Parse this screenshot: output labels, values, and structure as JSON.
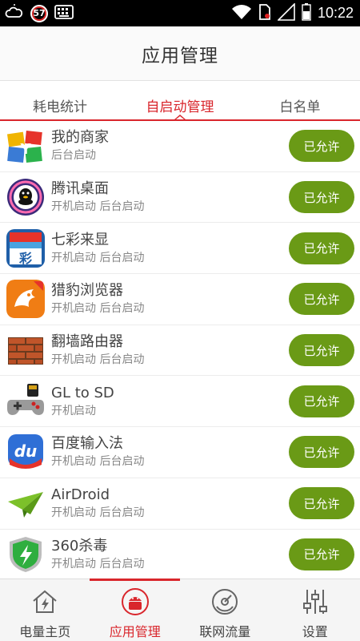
{
  "status_bar": {
    "time": "10:22",
    "badge": "57",
    "icons": [
      "weather-icon",
      "notification-badge",
      "keyboard-icon",
      "wifi-icon",
      "no-sim-icon",
      "signal-icon",
      "battery-icon"
    ]
  },
  "header": {
    "title": "应用管理"
  },
  "tabs": [
    {
      "label": "耗电统计",
      "active": false
    },
    {
      "label": "自启动管理",
      "active": true
    },
    {
      "label": "白名单",
      "active": false
    }
  ],
  "colors": {
    "accent": "#d9262c",
    "button": "#6a9a16"
  },
  "apps": [
    {
      "name": "我的商家",
      "sub": "后台启动",
      "button": "已允许",
      "icon": "my-merchant-icon"
    },
    {
      "name": "腾讯桌面",
      "sub": "开机启动 后台启动",
      "button": "已允许",
      "icon": "tencent-desktop-icon"
    },
    {
      "name": "七彩来显",
      "sub": "开机启动 后台启动",
      "button": "已允许",
      "icon": "qicai-caller-icon"
    },
    {
      "name": "猎豹浏览器",
      "sub": "开机启动 后台启动",
      "button": "已允许",
      "icon": "cheetah-browser-icon"
    },
    {
      "name": "翻墙路由器",
      "sub": "开机启动 后台启动",
      "button": "已允许",
      "icon": "brick-wall-icon"
    },
    {
      "name": "GL to SD",
      "sub": "开机启动",
      "button": "已允许",
      "icon": "gamepad-icon"
    },
    {
      "name": "百度输入法",
      "sub": "开机启动 后台启动",
      "button": "已允许",
      "icon": "baidu-input-icon"
    },
    {
      "name": "AirDroid",
      "sub": "开机启动 后台启动",
      "button": "已允许",
      "icon": "airdroid-icon"
    },
    {
      "name": "360杀毒",
      "sub": "开机启动 后台启动",
      "button": "已允许",
      "icon": "360-antivirus-icon"
    }
  ],
  "bottom_nav": [
    {
      "label": "电量主页",
      "icon": "power-home-icon",
      "active": false
    },
    {
      "label": "应用管理",
      "icon": "android-app-icon",
      "active": true
    },
    {
      "label": "联网流量",
      "icon": "network-traffic-icon",
      "active": false
    },
    {
      "label": "设置",
      "icon": "settings-sliders-icon",
      "active": false
    }
  ]
}
